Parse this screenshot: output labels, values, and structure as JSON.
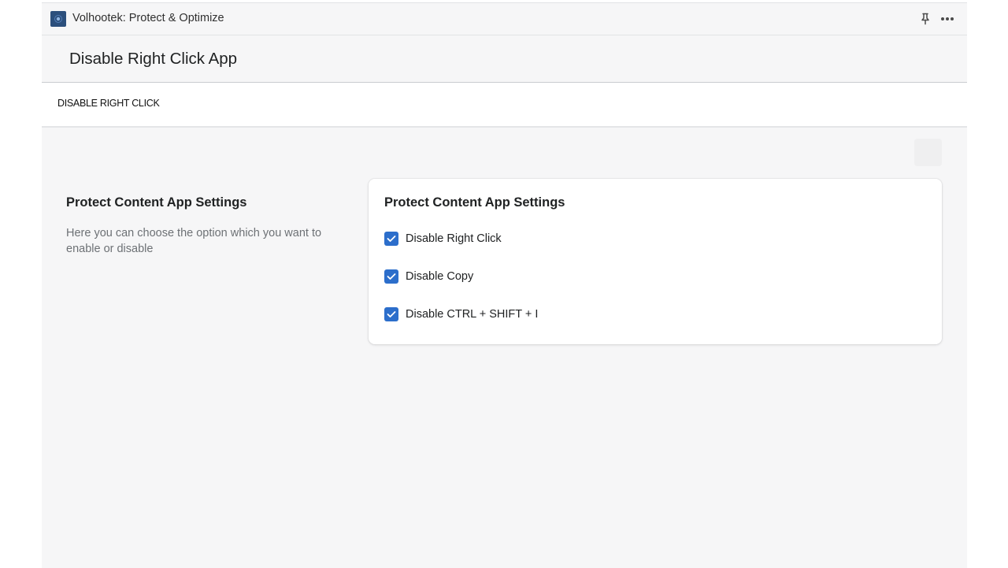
{
  "app": {
    "name": "Volhootek: Protect & Optimize",
    "icon": "app-logo-icon",
    "actions": [
      "pin-icon",
      "more-options-icon"
    ]
  },
  "page": {
    "title": "Disable Right Click App"
  },
  "tabs": [
    {
      "label": "DISABLE RIGHT CLICK"
    }
  ],
  "settings_section": {
    "heading": "Protect Content App Settings",
    "description": "Here you can choose the option which you want to enable or disable"
  },
  "settings_card": {
    "heading": "Protect Content App Settings",
    "options": [
      {
        "label": "Disable Right Click",
        "checked": true
      },
      {
        "label": "Disable Copy",
        "checked": true
      },
      {
        "label": "Disable CTRL + SHIFT + I",
        "checked": true
      }
    ]
  },
  "colors": {
    "checkbox_checked": "#2c6ecb",
    "app_icon_bg": "#2c4f7c",
    "page_bg": "#f6f6f7",
    "card_bg": "#ffffff"
  }
}
